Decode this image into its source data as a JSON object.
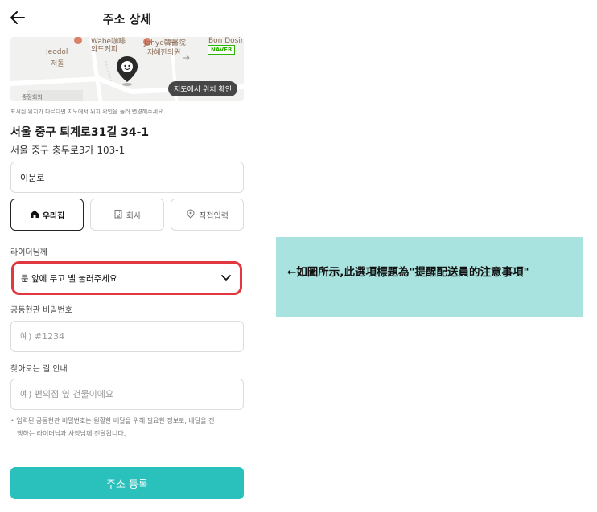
{
  "header": {
    "title": "주소 상세"
  },
  "map": {
    "labels": [
      "Wabe咖啡",
      "와드커피",
      "Jeodol",
      "저돌",
      "Jahye韓醫院",
      "자혜한의원",
      "Bon Dosin",
      "NAVER",
      "중정회의"
    ],
    "confirm_button": "지도에서 위치 확인"
  },
  "map_note": "표시된 위치가 다르다면 지도에서 위치 확인을 눌러 변경해주세요",
  "address": {
    "road": "서울 중구 퇴계로31길 34-1",
    "lot": "서울 중구 충무로3가 103-1"
  },
  "detail_input": {
    "value": "이문로"
  },
  "tags": [
    {
      "label": "우리집",
      "icon": "home-icon"
    },
    {
      "label": "회사",
      "icon": "building-icon"
    },
    {
      "label": "직접입력",
      "icon": "location-pin-icon"
    }
  ],
  "rider": {
    "label": "라이더님께",
    "selected": "문 앞에 두고 벨 눌러주세요"
  },
  "entrance": {
    "label": "공동현관 비밀번호",
    "placeholder": "예) #1234"
  },
  "directions": {
    "label": "찾아오는 길 안내",
    "placeholder": "예) 편의점 옆 건물이에요"
  },
  "notice": {
    "line1": "• 입력된 공동현관 비밀번호는 원활한 배달을 위해 필요한 정보로, 배달을 진",
    "line2": "행하는 라이더님과 사장님께 전달됩니다."
  },
  "submit": {
    "label": "주소 등록"
  },
  "annotation": {
    "text": "←如圖所示,此選項標題為\"提醒配送員的注意事項\""
  },
  "colors": {
    "accent": "#2ac1bc",
    "highlight": "#e0383e",
    "annotation_bg": "#a8e3df"
  }
}
